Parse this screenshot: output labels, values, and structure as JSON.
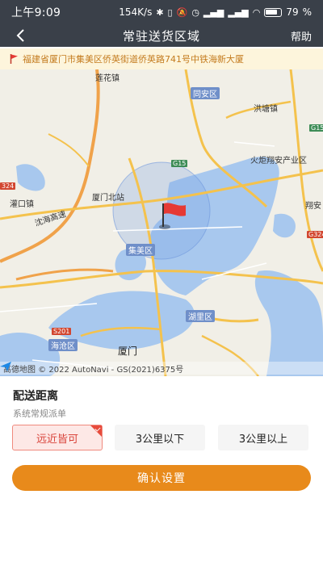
{
  "status_bar": {
    "time": "上午9:09",
    "network_speed": "154K/s",
    "battery": "79"
  },
  "nav": {
    "title": "常驻送货区域",
    "help": "帮助",
    "back_icon": "back-arrow-icon"
  },
  "address": {
    "text": "福建省厦门市集美区侨英街道侨英路741号中铁海新大厦",
    "icon": "red-flag-icon"
  },
  "map": {
    "labels": {
      "lianhua": "莲花镇",
      "tongan": "同安区",
      "hongtang": "洪塘镇",
      "huoju": "火炬翔安产业区",
      "guankou": "灌口镇",
      "xiamen_north": "厦门北站",
      "shenhai": "沈海高速",
      "jimei": "集美区",
      "xiang": "翔安",
      "huli": "湖里区",
      "haicang": "海沧区",
      "xiamen": "厦门"
    },
    "shields": {
      "g15": "G15",
      "s324": "324",
      "g324": "G324",
      "s201": "S201",
      "g15b": "G15"
    },
    "attribution": "高德地图 © 2022 AutoNavi - GS(2021)6375号",
    "pin_icon": "red-flag-pin-icon"
  },
  "distance": {
    "title": "配送距离",
    "subtitle": "系统常规派单",
    "options": [
      "远近皆可",
      "3公里以下",
      "3公里以上"
    ],
    "selected_index": 0
  },
  "confirm": "确认设置",
  "colors": {
    "header": "#3a4049",
    "accent": "#e88a1b",
    "selected_bg": "#fde8e6",
    "selected_text": "#d9433a",
    "address_text": "#c47b1e"
  }
}
